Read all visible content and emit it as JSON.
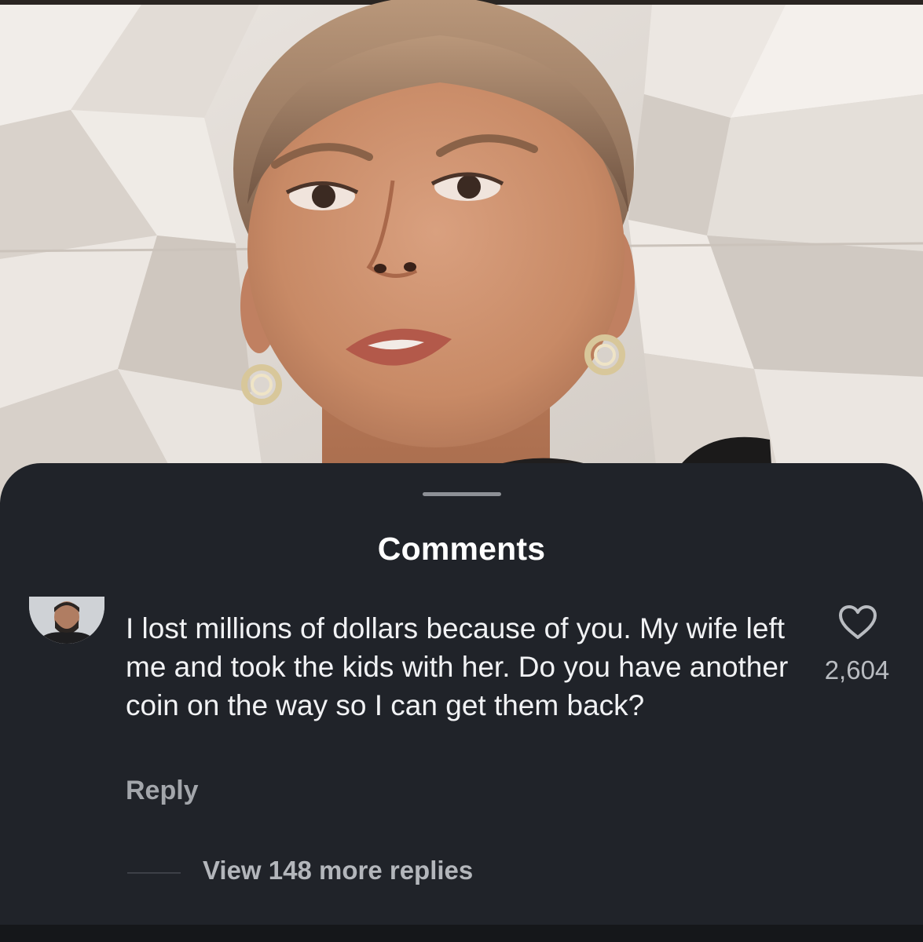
{
  "sheet": {
    "title": "Comments"
  },
  "comment": {
    "text": "I lost millions of dollars because of you. My wife left me and took the kids with her. Do you have another coin on the way so I can get them back?",
    "like_count": "2,604",
    "reply_label": "Reply",
    "view_replies_label": "View 148 more replies"
  },
  "icons": {
    "like": "heart-outline-icon",
    "avatar": "user-avatar"
  },
  "colors": {
    "sheet_background": "#202329",
    "text_primary": "#f1f2f4",
    "text_secondary": "#a3a6ab"
  }
}
